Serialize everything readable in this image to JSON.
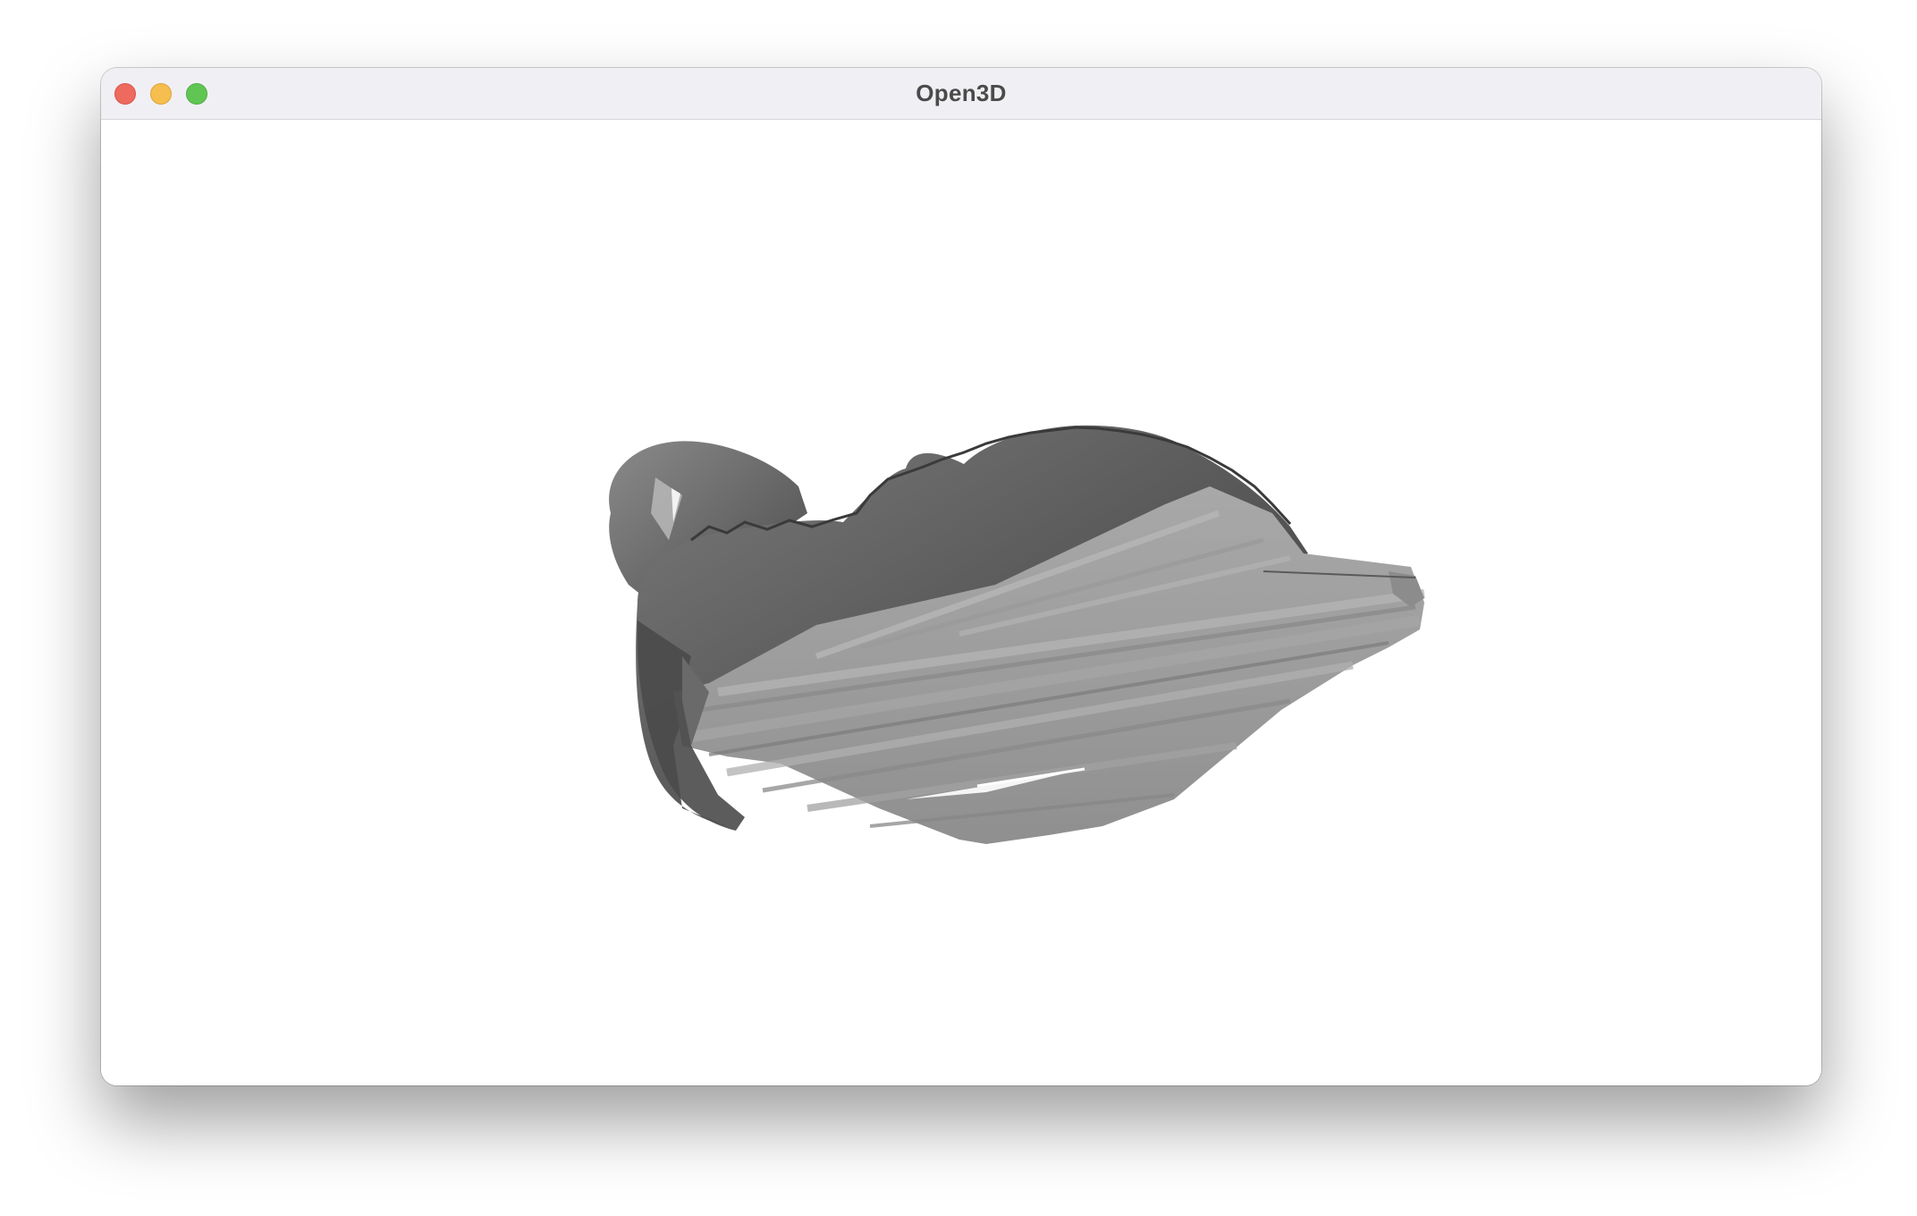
{
  "window": {
    "title": "Open3D"
  },
  "traffic_lights": {
    "close": "close-icon",
    "minimize": "minimize-icon",
    "maximize": "maximize-icon"
  },
  "viewport": {
    "content": "3d-mesh-render",
    "background": "#ffffff",
    "mesh_color": "#9a9a9a"
  }
}
